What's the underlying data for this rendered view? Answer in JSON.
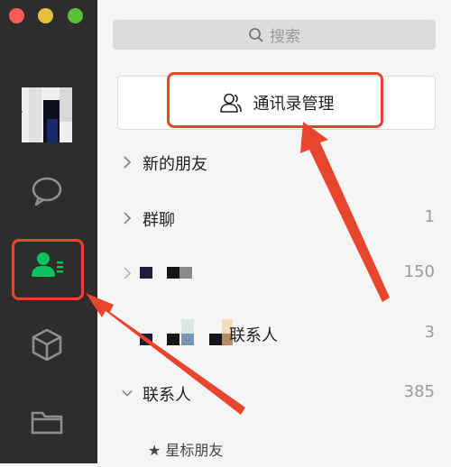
{
  "window": {
    "controls": [
      "close",
      "minimize",
      "zoom"
    ]
  },
  "sidebar": {
    "icons": [
      "chat-icon",
      "contacts-icon",
      "box-icon",
      "folder-icon"
    ],
    "active": "contacts"
  },
  "search": {
    "placeholder": "搜索"
  },
  "manage_button": {
    "label": "通讯录管理"
  },
  "list": {
    "new_friends": {
      "label": "新的朋友"
    },
    "group_chats": {
      "label": "群聊",
      "count": "1"
    },
    "blurred_row_1": {
      "count": "150"
    },
    "blurred_row_2": {
      "label_suffix": "联系人",
      "count": "3"
    },
    "contacts": {
      "label": "联系人",
      "count": "385"
    },
    "starred": {
      "label": "★ 星标朋友"
    }
  },
  "colors": {
    "sidebar_bg": "#2f2d2b",
    "accent_green": "#07c160",
    "highlight_red": "#e8452e"
  }
}
